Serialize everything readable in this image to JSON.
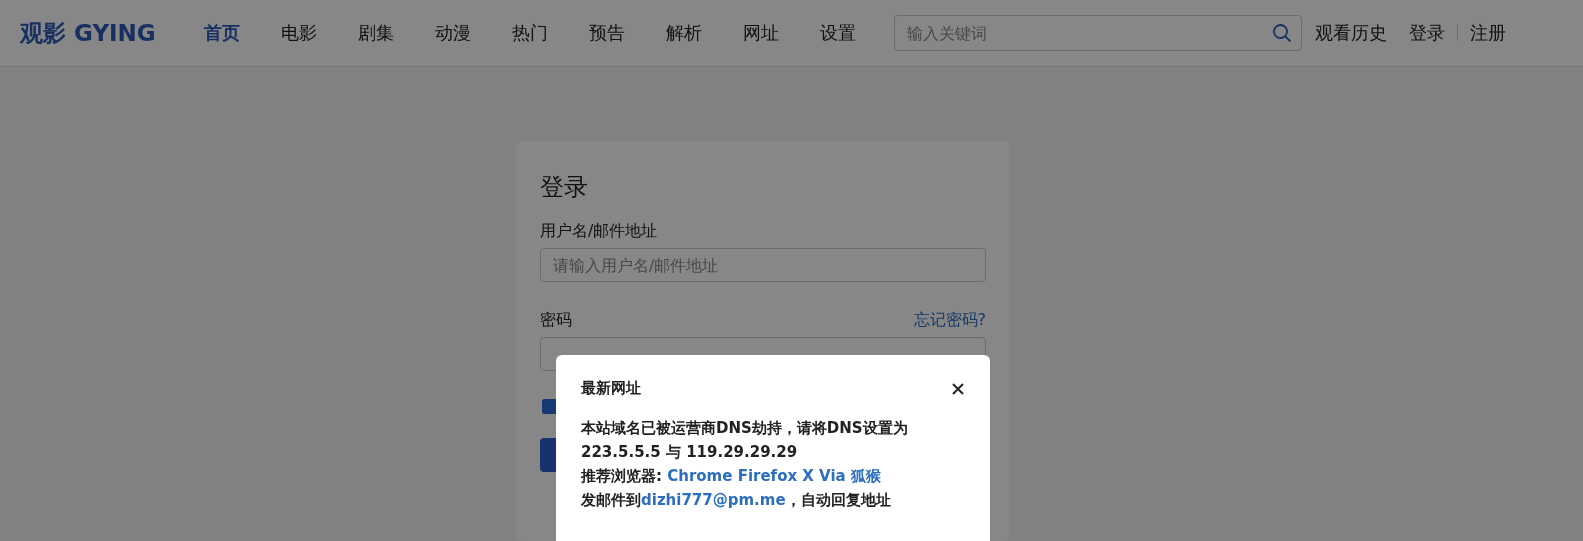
{
  "header": {
    "logo": "观影 GYING",
    "nav": [
      {
        "label": "首页",
        "selected": true
      },
      {
        "label": "电影",
        "selected": false
      },
      {
        "label": "剧集",
        "selected": false
      },
      {
        "label": "动漫",
        "selected": false
      },
      {
        "label": "热门",
        "selected": false
      },
      {
        "label": "预告",
        "selected": false
      },
      {
        "label": "解析",
        "selected": false
      },
      {
        "label": "网址",
        "selected": false
      },
      {
        "label": "设置",
        "selected": false
      }
    ],
    "search": {
      "placeholder": "输入关键词"
    },
    "history": "观看历史",
    "login": "登录",
    "register": "注册"
  },
  "login": {
    "title": "登录",
    "username": {
      "label": "用户名/邮件地址",
      "placeholder": "请输入用户名/邮件地址"
    },
    "password": {
      "label": "密码",
      "forgot": "忘记密码?"
    },
    "remember": {
      "checked": true
    }
  },
  "modal": {
    "title": "最新网址",
    "lines": [
      {
        "text": "本站域名已被运营商DNS劫持，请将DNS设置为"
      },
      {
        "text": "223.5.5.5 与 119.29.29.29"
      },
      {
        "text": "推荐浏览器: ",
        "link": "Chrome Firefox X Via 狐猴"
      },
      {
        "text": "发邮件到",
        "link": "dizhi777@pm.me",
        "after": "，自动回复地址"
      }
    ]
  }
}
